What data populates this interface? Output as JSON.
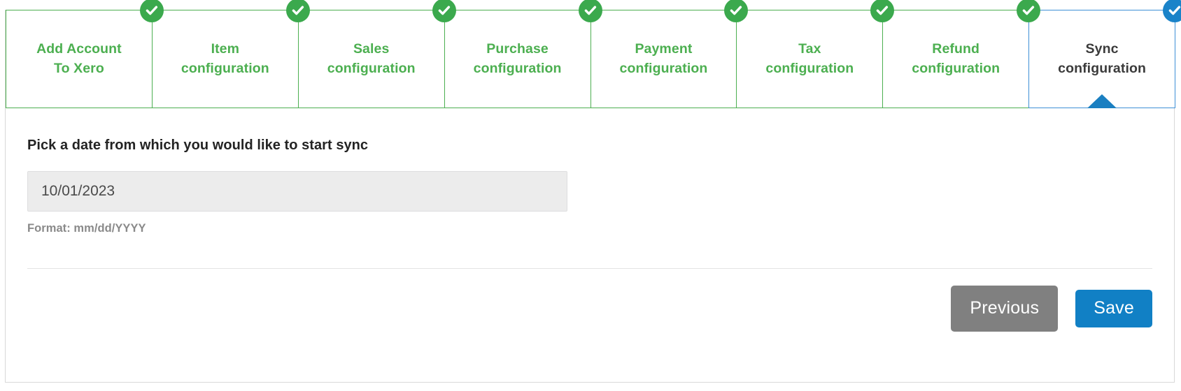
{
  "wizard": {
    "steps": [
      {
        "label": "Add Account\nTo Xero",
        "state": "complete",
        "badge_icon": "check-icon"
      },
      {
        "label": "Item\nconfiguration",
        "state": "complete",
        "badge_icon": "check-icon"
      },
      {
        "label": "Sales\nconfiguration",
        "state": "complete",
        "badge_icon": "check-icon"
      },
      {
        "label": "Purchase\nconfiguration",
        "state": "complete",
        "badge_icon": "check-icon"
      },
      {
        "label": "Payment\nconfiguration",
        "state": "complete",
        "badge_icon": "check-icon"
      },
      {
        "label": "Tax\nconfiguration",
        "state": "complete",
        "badge_icon": "check-icon"
      },
      {
        "label": "Refund\nconfiguration",
        "state": "complete",
        "badge_icon": "check-icon"
      },
      {
        "label": "Sync\nconfiguration",
        "state": "active",
        "badge_icon": "check-icon"
      }
    ],
    "complete_color": "#3ba94d",
    "active_color": "#1a83c9"
  },
  "form": {
    "date_label": "Pick a date from which you would like to start sync",
    "date_value": "10/01/2023",
    "date_placeholder": "mm/dd/YYYY",
    "format_hint": "Format: mm/dd/YYYY"
  },
  "actions": {
    "previous_label": "Previous",
    "save_label": "Save",
    "previous_color": "#808080",
    "save_color": "#1180c5"
  }
}
